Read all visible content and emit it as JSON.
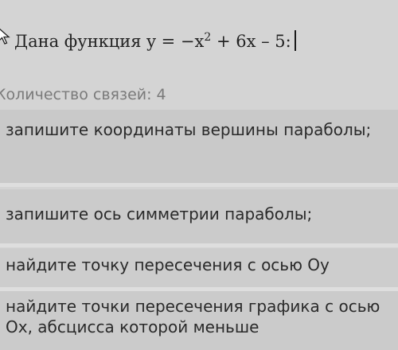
{
  "task": {
    "title_prefix": "Дана функция y = −x",
    "title_power": "2",
    "title_suffix": " + 6x – 5:"
  },
  "connections_label": "Количество связей: 4",
  "items": [
    {
      "label": "запишите координаты вершины параболы;"
    },
    {
      "label": "запишите ось симметрии параболы;"
    },
    {
      "label": "найдите точку пересечения с осью Оу"
    },
    {
      "label": "найдите точки пересечения графика с осью Ох, абсцисса которой меньше"
    }
  ]
}
